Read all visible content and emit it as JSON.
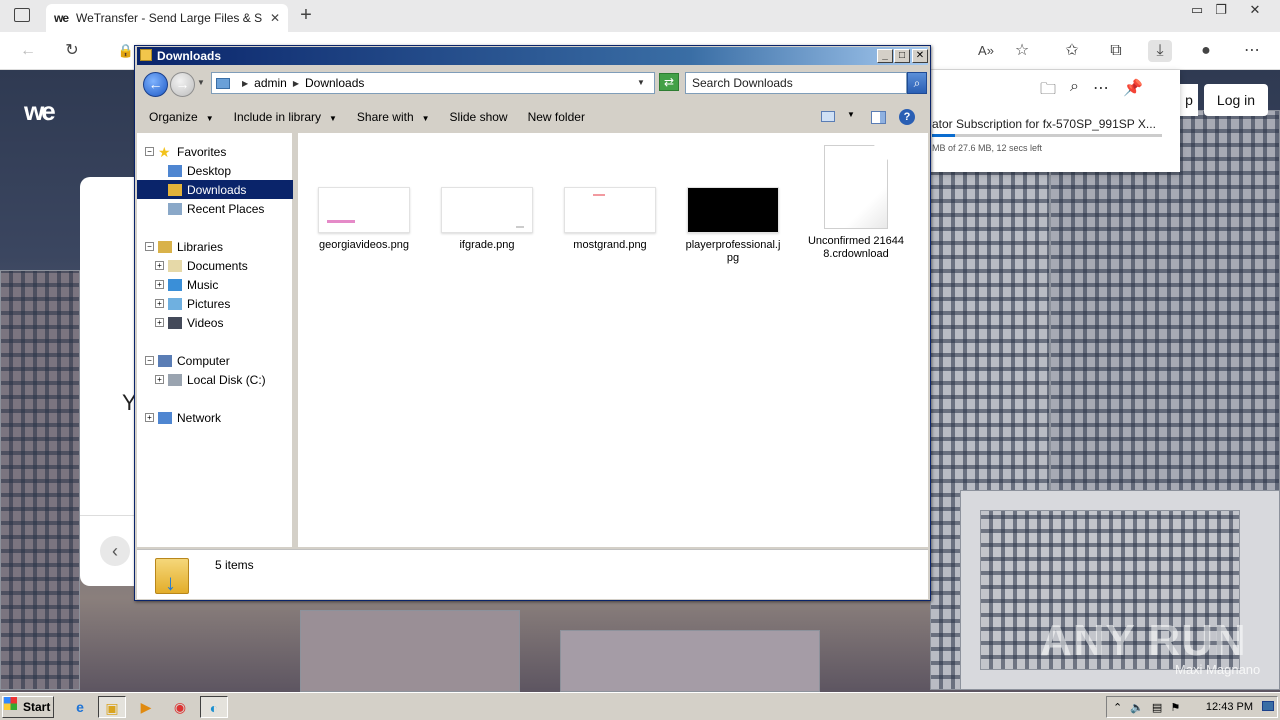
{
  "browser": {
    "tab_title": "WeTransfer - Send Large Files & S",
    "tab_favicon": "we",
    "tab_close": "✕",
    "new_tab": "+"
  },
  "page": {
    "logo": "we",
    "login": "Log in",
    "signup_partial": "p",
    "card_partial_text": "Y"
  },
  "download_flyout": {
    "filename": "ator Subscription for fx-570SP_991SP X...",
    "status": "MB of 27.6 MB, 12 secs left",
    "progress": 0.1
  },
  "explorer": {
    "title": "Downloads",
    "breadcrumb": [
      "admin",
      "Downloads"
    ],
    "search_placeholder": "Search Downloads",
    "commands": [
      {
        "label": "Organize",
        "dropdown": true
      },
      {
        "label": "Include in library",
        "dropdown": true
      },
      {
        "label": "Share with",
        "dropdown": true
      },
      {
        "label": "Slide show",
        "dropdown": false
      },
      {
        "label": "New folder",
        "dropdown": false
      }
    ],
    "nav_tree": [
      {
        "label": "Favorites",
        "icon": "star-icon",
        "level": 0,
        "expander": "−"
      },
      {
        "label": "Desktop",
        "icon": "desktop-icon",
        "level": 1
      },
      {
        "label": "Downloads",
        "icon": "downloads-folder-icon",
        "level": 1,
        "selected": true
      },
      {
        "label": "Recent Places",
        "icon": "recent-places-icon",
        "level": 1
      },
      {
        "label": "Libraries",
        "icon": "libraries-icon",
        "level": 0,
        "expander": "−"
      },
      {
        "label": "Documents",
        "icon": "documents-icon",
        "level": 1,
        "expander": "+"
      },
      {
        "label": "Music",
        "icon": "music-icon",
        "level": 1,
        "expander": "+"
      },
      {
        "label": "Pictures",
        "icon": "pictures-icon",
        "level": 1,
        "expander": "+"
      },
      {
        "label": "Videos",
        "icon": "videos-icon",
        "level": 1,
        "expander": "+"
      },
      {
        "label": "Computer",
        "icon": "computer-icon",
        "level": 0,
        "expander": "−"
      },
      {
        "label": "Local Disk (C:)",
        "icon": "disk-icon",
        "level": 1,
        "expander": "+"
      },
      {
        "label": "Network",
        "icon": "network-icon",
        "level": 0,
        "expander": "+"
      }
    ],
    "files": [
      {
        "name": "georgiavideos.png",
        "thumb": "white-pink-text"
      },
      {
        "name": "ifgrade.png",
        "thumb": "white"
      },
      {
        "name": "mostgrand.png",
        "thumb": "white-red-dot"
      },
      {
        "name": "playerprofessional.jpg",
        "thumb": "black"
      },
      {
        "name": "Unconfirmed 216448.crdownload",
        "thumb": "generic-file"
      }
    ],
    "item_count": "5 items"
  },
  "taskbar": {
    "start": "Start",
    "clock": "12:43 PM"
  },
  "watermark": {
    "brand": "ANY RUN",
    "author": "Maxi Magnano"
  },
  "colors": {
    "title_bar": "#0a246a",
    "selection": "#0a246a",
    "progress": "#0a6ccf"
  }
}
